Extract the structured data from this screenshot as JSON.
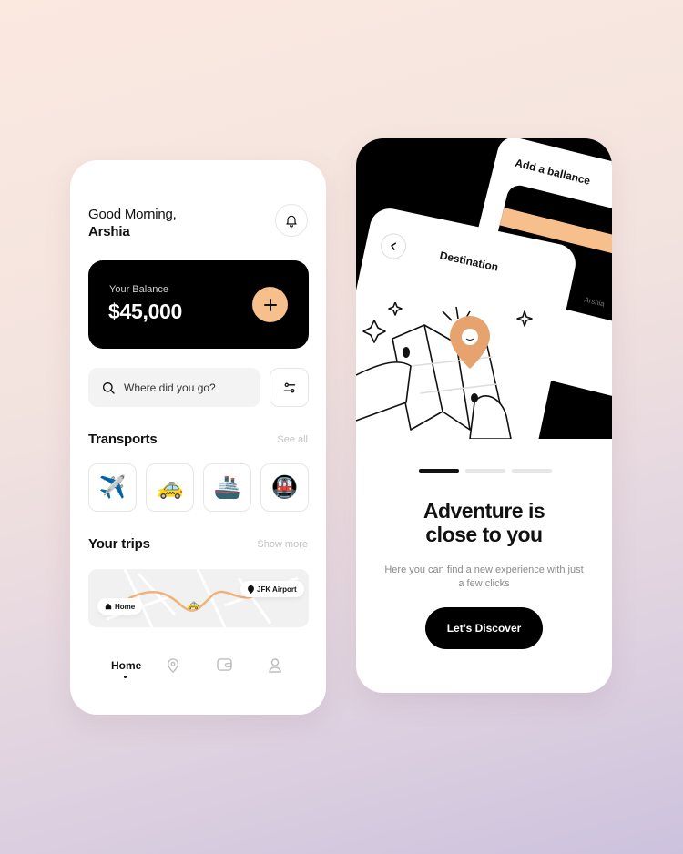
{
  "home_screen": {
    "greeting_line1": "Good Morning,",
    "greeting_name": "Arshia",
    "balance": {
      "label": "Your Balance",
      "amount": "$45,000"
    },
    "search": {
      "placeholder": "Where did you go?"
    },
    "transports": {
      "title": "Transports",
      "link": "See all",
      "items": [
        {
          "icon": "airplane-icon",
          "glyph": "✈️"
        },
        {
          "icon": "taxi-icon",
          "glyph": "🚕"
        },
        {
          "icon": "ship-icon",
          "glyph": "🚢"
        },
        {
          "icon": "metro-icon",
          "glyph": "🚇"
        }
      ]
    },
    "trips": {
      "title": "Your trips",
      "link": "Show more",
      "from": "Home",
      "to": "JFK Airport"
    },
    "nav": {
      "active_label": "Home"
    }
  },
  "onboarding_screen": {
    "add_balance_caption": "Add a ballance",
    "card_holder": "Arshia",
    "destination_title": "Destination",
    "headline_line1": "Adventure is",
    "headline_line2": "close to you",
    "subtitle": "Here you can find a new experience with just a few clicks",
    "cta_label": "Let’s Discover",
    "pager_total": 3,
    "pager_active": 1
  },
  "colors": {
    "accent": "#f6bf8c",
    "dark": "#000000"
  }
}
